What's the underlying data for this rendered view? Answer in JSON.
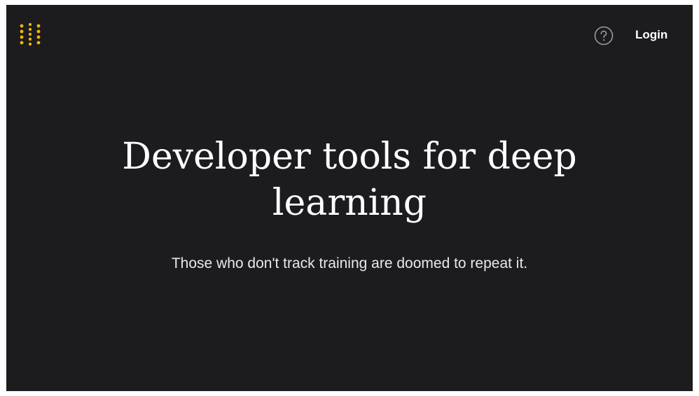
{
  "header": {
    "logo_icon": "dots-grid-logo",
    "logo_color": "#f7b500",
    "help_icon": "question-circle-icon",
    "login_label": "Login"
  },
  "hero": {
    "title": "Developer tools for deep learning",
    "subtitle": "Those who don't track training are doomed to repeat it."
  },
  "colors": {
    "background": "#1c1c1f",
    "text": "#ffffff"
  }
}
